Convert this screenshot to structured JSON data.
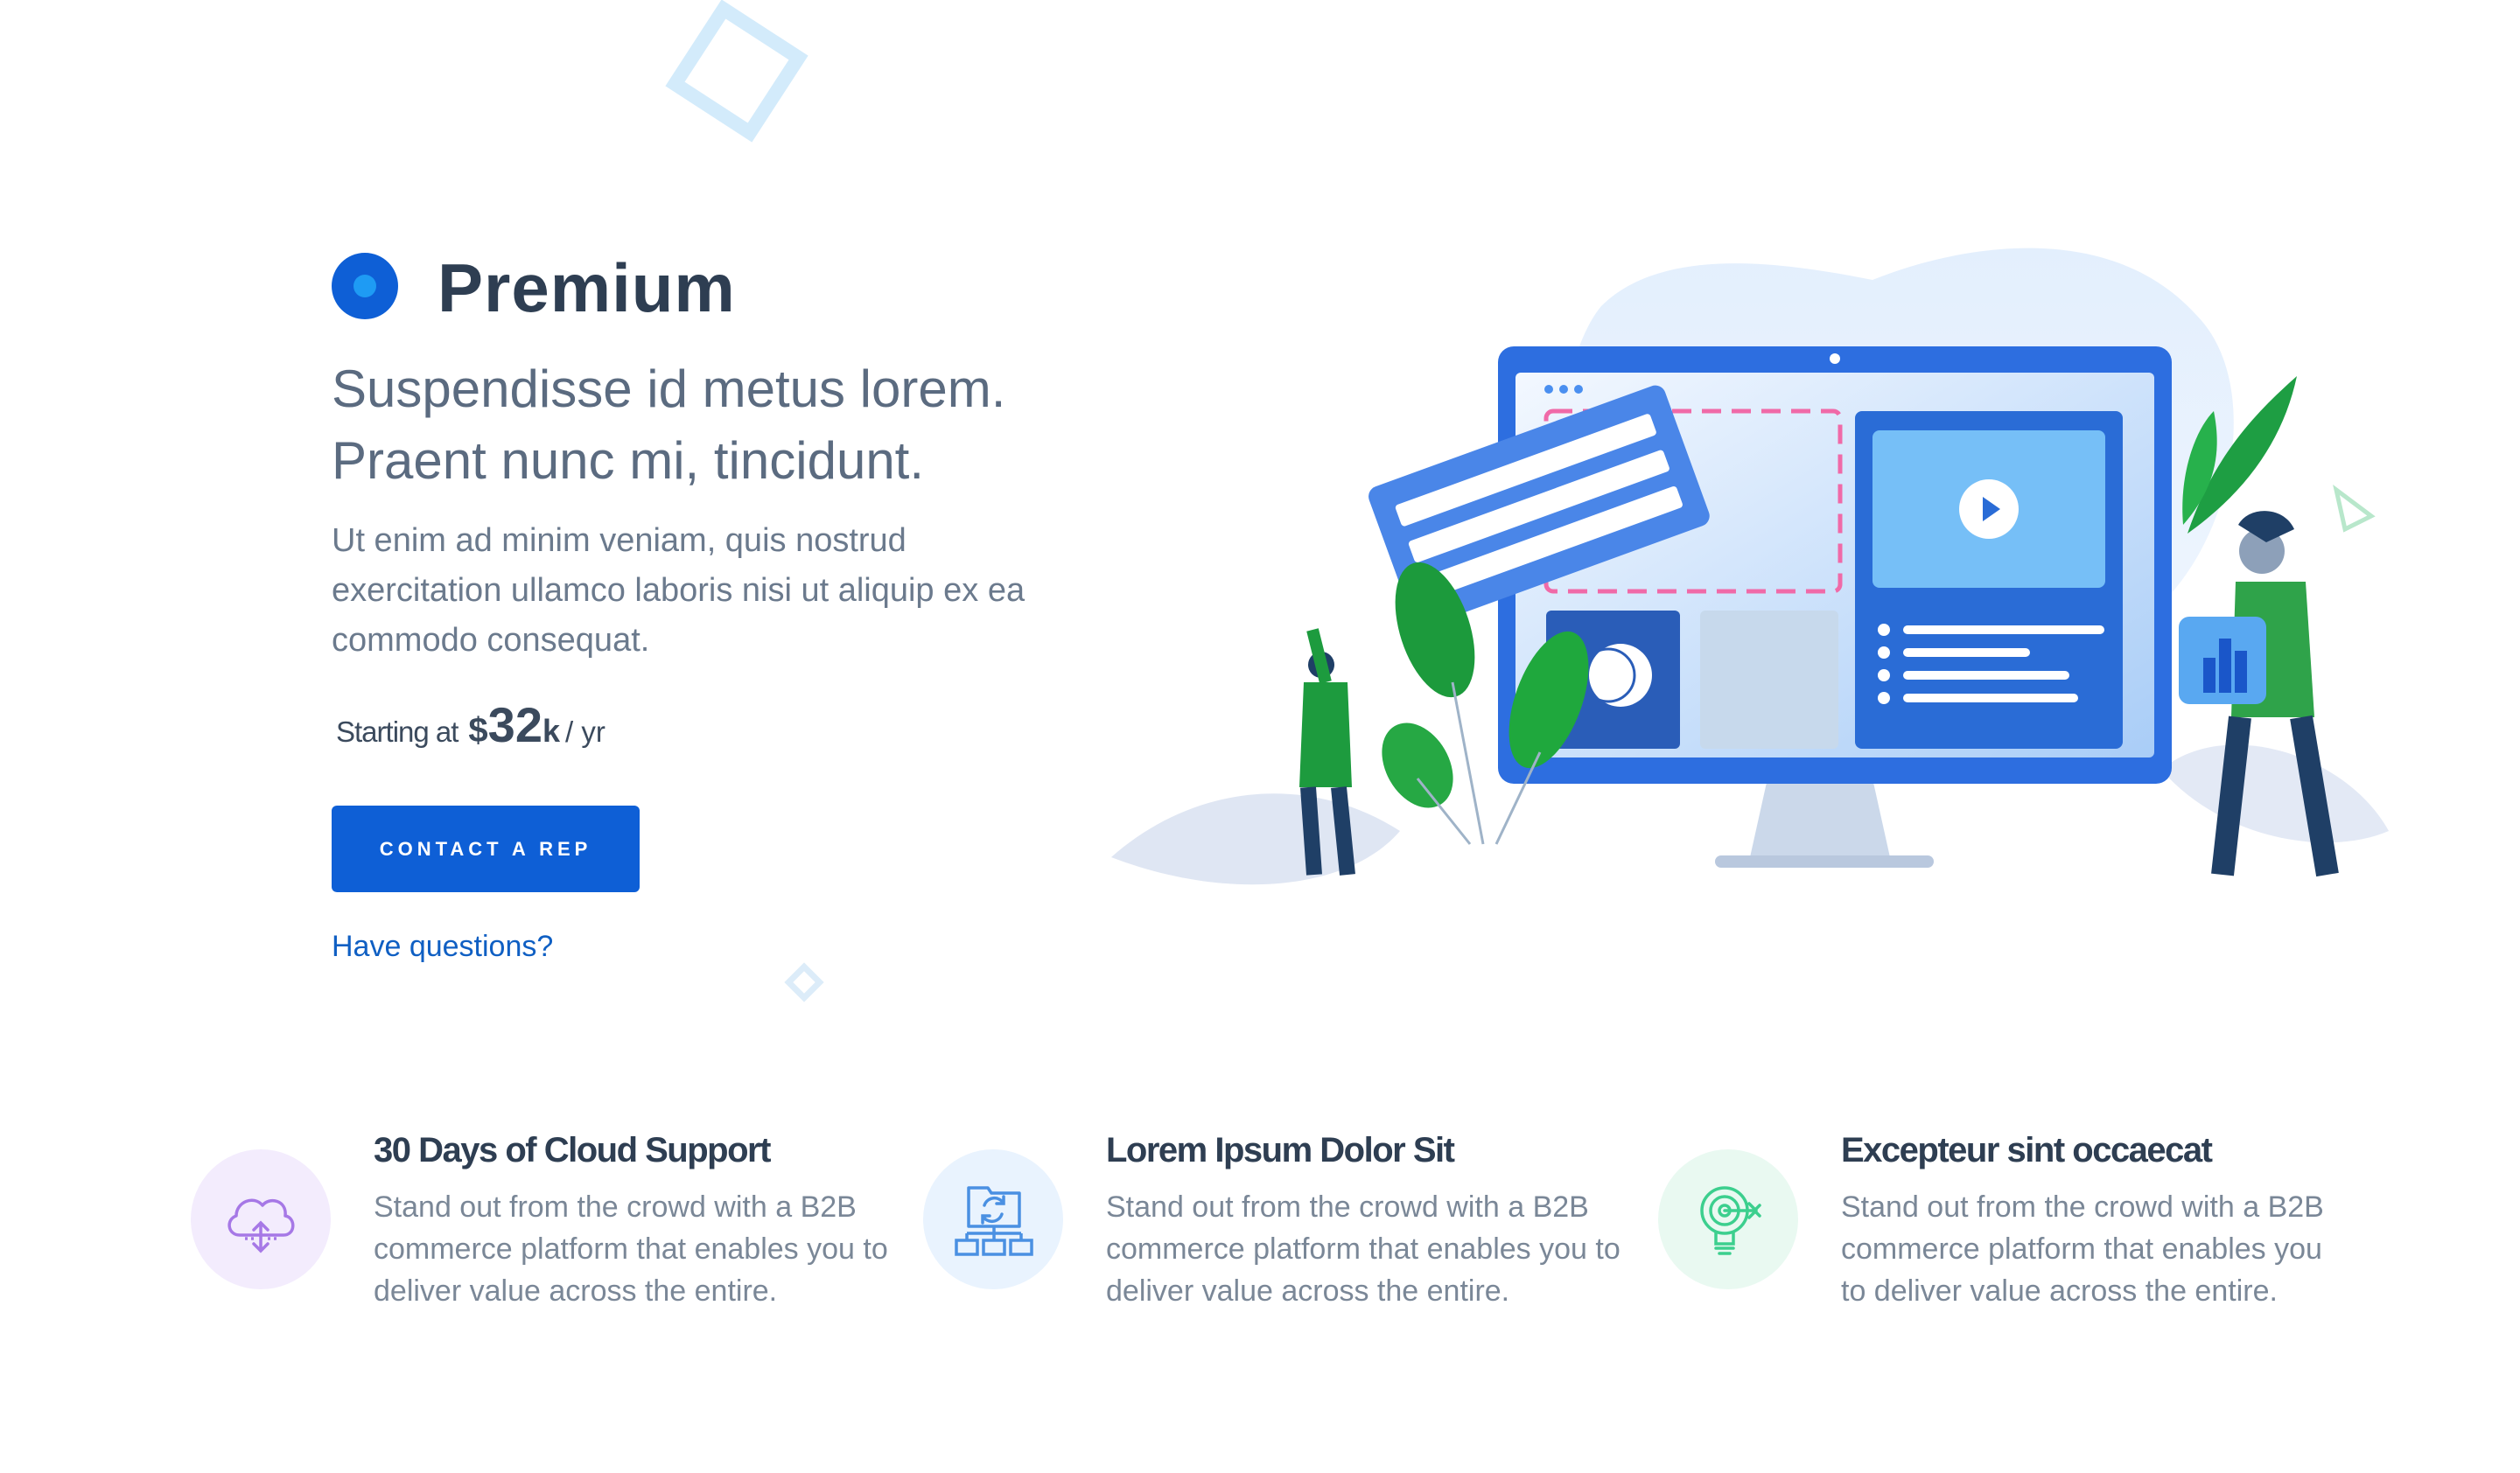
{
  "hero": {
    "plan_name": "Premium",
    "headline_line1": "Suspendisse id metus lorem.",
    "headline_line2": "Praent nunc mi, tincidunt.",
    "body": "Ut enim ad minim veniam, quis nostrud exercitation ullamco laboris nisi ut aliquip ex ea commodo consequat.",
    "price": {
      "prefix": "Starting at",
      "currency": "$",
      "amount": "32",
      "unit": "k",
      "period": "/ yr"
    },
    "cta_label": "CONTACT A REP",
    "questions_link": "Have questions?"
  },
  "features": [
    {
      "icon": "cloud-sync-icon",
      "title": "30 Days of Cloud Support",
      "description": "Stand out from the crowd with a B2B commerce platform that enables you to deliver value across the entire."
    },
    {
      "icon": "network-sync-icon",
      "title": "Lorem Ipsum Dolor Sit",
      "description": "Stand out from the crowd with a B2B commerce platform that enables you to deliver value across the entire."
    },
    {
      "icon": "target-lightbulb-icon",
      "title": "Excepteur sint occaecat",
      "description": "Stand out from the crowd with a B2B commerce platform that enables you to deliver value across the entire."
    }
  ],
  "colors": {
    "primary": "#0e5fd6",
    "accent_light": "#1e9bf4",
    "heading": "#2e3e52",
    "body_text": "#6b7a8d",
    "link": "#0f5fc3",
    "cloud_icon": "#a678e6",
    "network_icon": "#4a90e2",
    "bulb_icon": "#3ccf8e"
  }
}
